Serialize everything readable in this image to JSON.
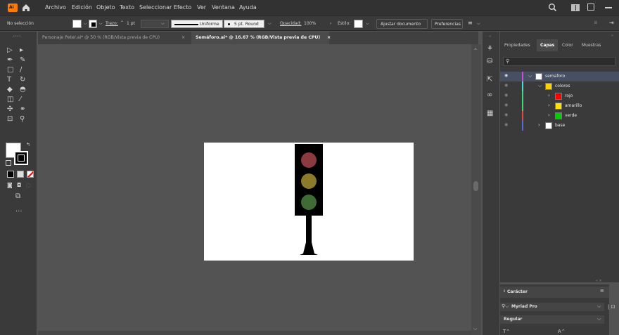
{
  "app": {
    "logo": "Ai"
  },
  "menu": [
    "Archivo",
    "Edición",
    "Objeto",
    "Texto",
    "Seleccionar",
    "Efecto",
    "Ver",
    "Ventana",
    "Ayuda"
  ],
  "controlbar": {
    "selection": "No selección",
    "stroke_label": "Trazo:",
    "stroke_value": "1 pt",
    "profile": "Uniforme",
    "brush": "5 pt. Round",
    "opacity_label": "Opacidad:",
    "opacity_value": "100%",
    "style_label": "Estilo:",
    "fit_button": "Ajustar documento",
    "prefs_button": "Preferencias"
  },
  "tabs": [
    {
      "label": "Personaje Peter.ai* @ 50 % (RGB/Vista previa de CPU)",
      "active": false
    },
    {
      "label": "Semáforo.ai* @ 16.67 % (RGB/Vista previa de CPU)",
      "active": true
    }
  ],
  "close_glyph": "×",
  "right_panel": {
    "tabs": [
      "Propiedades",
      "Capas",
      "Color",
      "Muestras"
    ],
    "active_tab": "Capas",
    "search_placeholder": "",
    "layers": [
      {
        "name": "semaforo",
        "depth": 0,
        "color": "#c64fd8",
        "swatch": "#ffffff",
        "expanded": true,
        "selected": true
      },
      {
        "name": "colores",
        "depth": 1,
        "color": "#4fd8d8",
        "swatch": "#ffd200",
        "expanded": true,
        "selected": false
      },
      {
        "name": "rojo",
        "depth": 2,
        "color": "#3dd87a",
        "swatch": "#ff0000",
        "expanded": false,
        "selected": false
      },
      {
        "name": "amarillo",
        "depth": 2,
        "color": "#3dd87a",
        "swatch": "#ffe000",
        "expanded": false,
        "selected": false
      },
      {
        "name": "verde",
        "depth": 2,
        "color": "#e04a4a",
        "swatch": "#00d000",
        "expanded": false,
        "selected": false
      },
      {
        "name": "base",
        "depth": 1,
        "color": "#4f6fd8",
        "swatch": "#ffffff",
        "expanded": false,
        "selected": false
      }
    ]
  },
  "character_panel": {
    "title": "Carácter",
    "font": "Myriad Pro",
    "style": "Regular"
  },
  "colors": {
    "accent": "#1473e6",
    "light_red": "#8b3a3f",
    "light_yellow": "#8a7a2a",
    "light_green": "#3f6b35"
  }
}
